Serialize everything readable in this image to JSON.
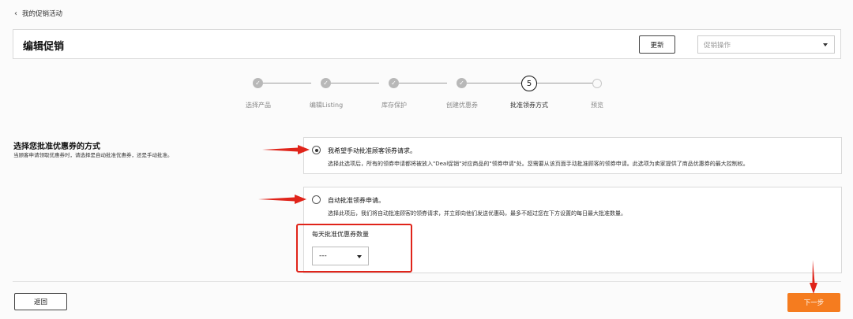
{
  "breadcrumb": {
    "icon": "chevron-left-icon",
    "label": "我的促销活动"
  },
  "header": {
    "title": "编辑促销",
    "update_label": "更新",
    "action_select_placeholder": "促销操作"
  },
  "stepper": {
    "current_step_number": "5",
    "steps": [
      {
        "label": "选择产品",
        "status": "done"
      },
      {
        "label": "编辑Listing",
        "status": "done"
      },
      {
        "label": "库存保护",
        "status": "done"
      },
      {
        "label": "创建优惠券",
        "status": "done"
      },
      {
        "label": "批准领券方式",
        "status": "current"
      },
      {
        "label": "预览",
        "status": "pending"
      }
    ]
  },
  "section": {
    "title": "选择您批准优惠券的方式",
    "description": "当顾客申请领取优惠券时，请选择是自动批准优惠券，还是手动批准。"
  },
  "options": [
    {
      "title": "我希望手动批准顾客领券请求。",
      "description": "选择此选项后，所有的领券申请都将被放入\"Deal促销\"对应商品的\"领券申请\"处。您需要从该页面手动批准顾客的领券申请。此选项为卖家提供了商品优惠券的最大控制权。",
      "selected": true
    },
    {
      "title": "自动批准领券申请。",
      "description": "选择此项后，我们将自动批准顾客的领券请求，并立即向他们发送优惠码，最多不超过您在下方设置的每日最大批准数量。",
      "selected": false
    }
  ],
  "daily_quota": {
    "label": "每天批准优惠券数量",
    "value": "---"
  },
  "footer": {
    "back_label": "返回",
    "next_label": "下一步"
  },
  "colors": {
    "accent": "#f57c1f",
    "annotation": "#e0241a"
  }
}
